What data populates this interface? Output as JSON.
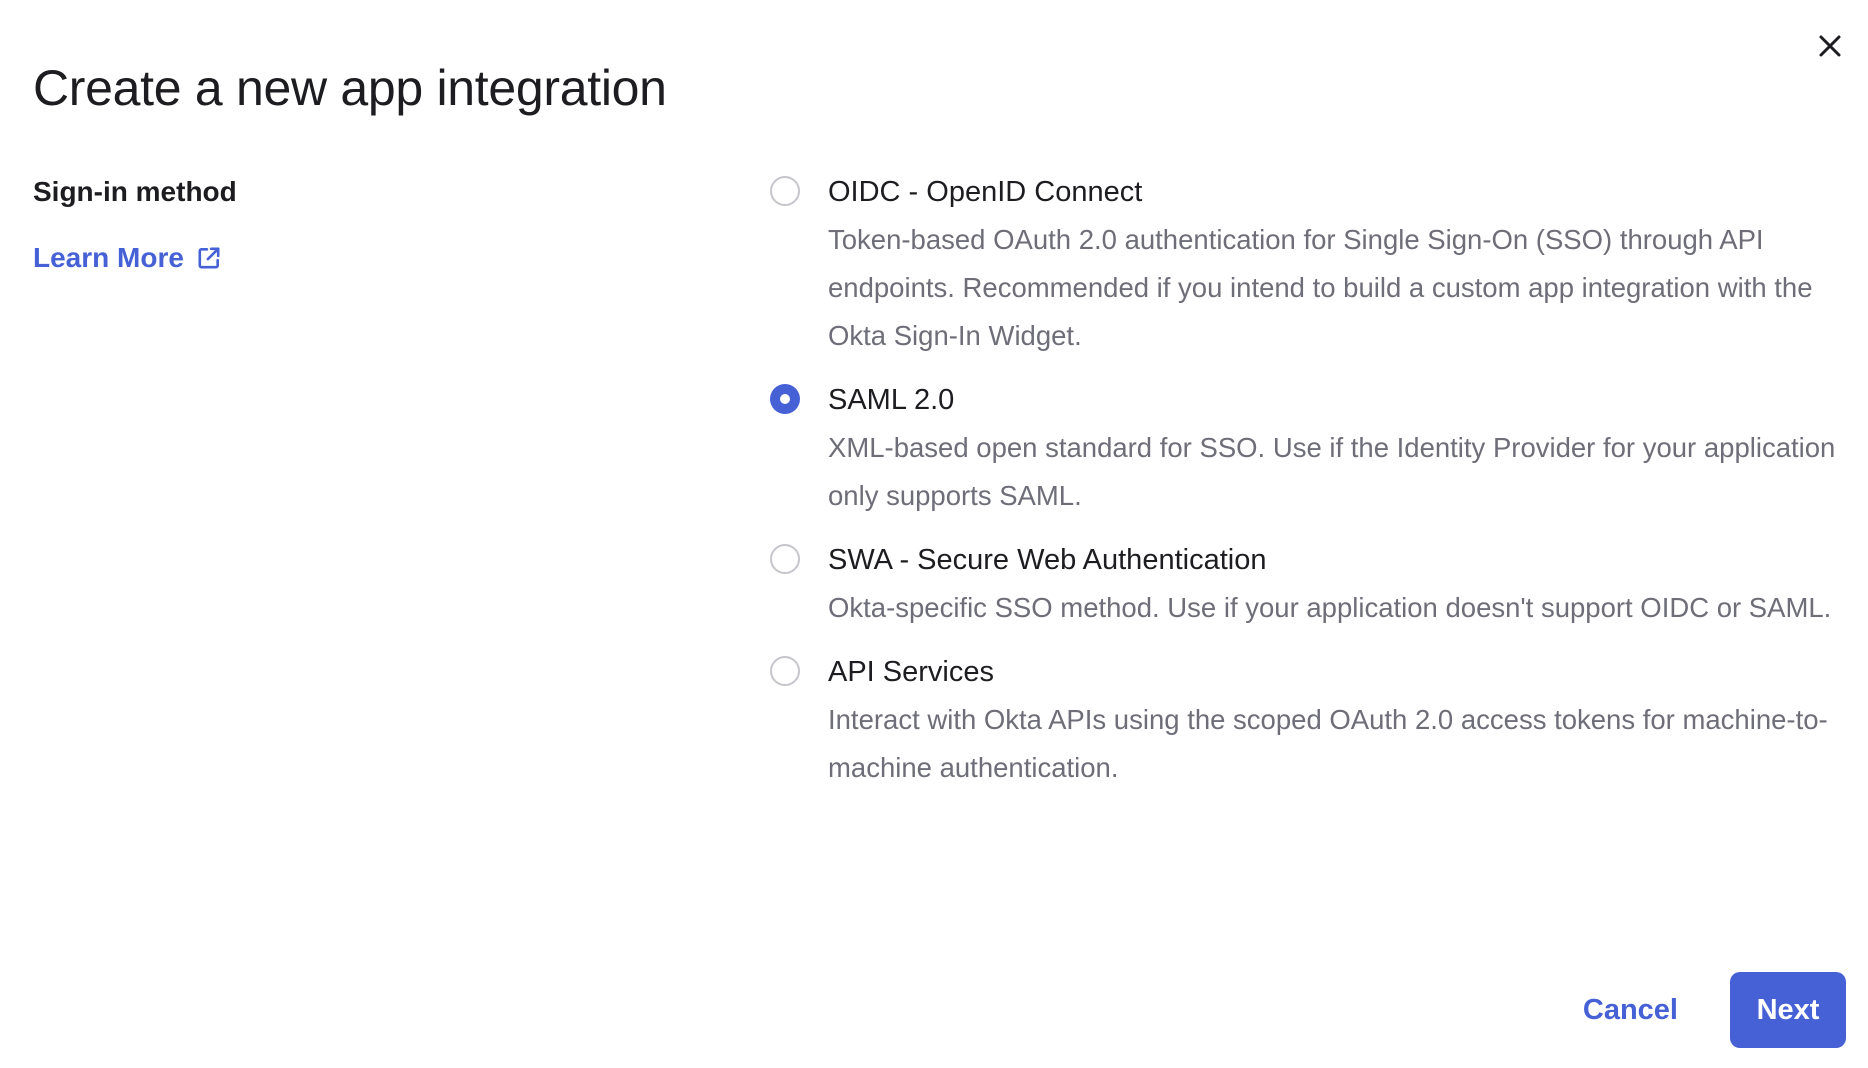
{
  "dialog": {
    "title": "Create a new app integration",
    "close_icon": "close-icon"
  },
  "left": {
    "section_label": "Sign-in method",
    "learn_more_label": "Learn More",
    "learn_more_icon": "external-link-icon"
  },
  "options": [
    {
      "title": "OIDC - OpenID Connect",
      "description": "Token-based OAuth 2.0 authentication for Single Sign-On (SSO) through API endpoints. Recommended if you intend to build a custom app integration with the Okta Sign-In Widget.",
      "selected": false
    },
    {
      "title": "SAML 2.0",
      "description": "XML-based open standard for SSO. Use if the Identity Provider for your application only supports SAML.",
      "selected": true
    },
    {
      "title": "SWA - Secure Web Authentication",
      "description": "Okta-specific SSO method. Use if your application doesn't support OIDC or SAML.",
      "selected": false
    },
    {
      "title": "API Services",
      "description": "Interact with Okta APIs using the scoped OAuth 2.0 access tokens for machine-to-machine authentication.",
      "selected": false
    }
  ],
  "footer": {
    "cancel_label": "Cancel",
    "next_label": "Next"
  },
  "colors": {
    "accent": "#4661d6",
    "text_primary": "#1d1d21",
    "text_secondary": "#6e6e78",
    "radio_border": "#c4c6cc"
  }
}
